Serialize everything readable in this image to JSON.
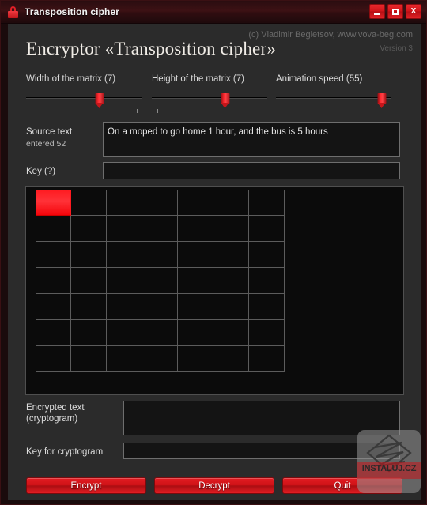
{
  "window": {
    "title": "Transposition cipher",
    "lock_icon": "lock-icon",
    "controls": {
      "minimize": "_",
      "maximize": "□",
      "close": "X"
    }
  },
  "header": {
    "heading": "Encryptor «Transposition cipher»",
    "copyright": "(c) Vladimir Begletsov, www.vova-beg.com",
    "version": "Version 3"
  },
  "sliders": [
    {
      "label": "Width of the matrix (7)",
      "value": 7,
      "percent": 61
    },
    {
      "label": "Height of the matrix (7)",
      "value": 7,
      "percent": 61
    },
    {
      "label": "Animation speed (55)",
      "value": 55,
      "percent": 88
    }
  ],
  "source": {
    "label": "Source text",
    "counter": "entered 52",
    "value": "On a moped to go home 1 hour, and the bus is 5 hours",
    "placeholder": ""
  },
  "key": {
    "label": "Key (?)",
    "value": "",
    "placeholder": ""
  },
  "matrix": {
    "columns": 7,
    "rows": 7,
    "active_cell": {
      "row": 0,
      "col": 0
    },
    "active_color": "#ff1a20",
    "grid_color": "#5c5c5c",
    "background": "#0b0b0b"
  },
  "encrypted": {
    "label": "Encrypted text\n(cryptogram)",
    "value": "",
    "placeholder": ""
  },
  "crypto_key": {
    "label": "Key for cryptogram",
    "value": "",
    "placeholder": ""
  },
  "buttons": [
    {
      "label": "Encrypt"
    },
    {
      "label": "Decrypt"
    },
    {
      "label": "Quit"
    }
  ],
  "watermark": {
    "text": "INSTALUJ.CZ"
  },
  "colors": {
    "accent_red": "#e01c22",
    "panel_bg": "#2b2b2b",
    "field_bg": "#141414",
    "title_bar": "#3d1114"
  }
}
